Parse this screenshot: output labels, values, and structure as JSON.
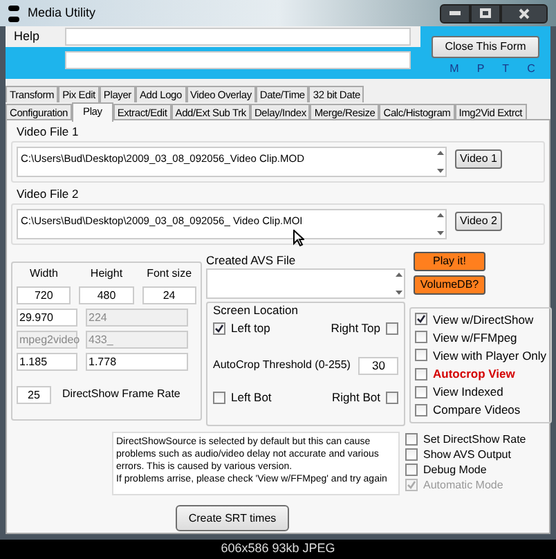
{
  "window": {
    "title": "Media Utility"
  },
  "menu": {
    "items": [
      "Help"
    ]
  },
  "close_button": "Close This Form",
  "indicators": [
    "M",
    "P",
    "T",
    "C"
  ],
  "tab_rows": [
    [
      {
        "label": "Transform",
        "selected": false
      },
      {
        "label": "Pix Edit",
        "selected": false
      },
      {
        "label": "Player",
        "selected": false
      },
      {
        "label": "Add Logo",
        "selected": false
      },
      {
        "label": "Video Overlay",
        "selected": false
      },
      {
        "label": "Date/Time",
        "selected": false
      },
      {
        "label": "32 bit Date",
        "selected": false
      }
    ],
    [
      {
        "label": "Configuration",
        "selected": false
      },
      {
        "label": "Play",
        "selected": true
      },
      {
        "label": "Extract/Edit",
        "selected": false
      },
      {
        "label": "Add/Ext Sub Trk",
        "selected": false
      },
      {
        "label": "Delay/Index",
        "selected": false
      },
      {
        "label": "Merge/Resize",
        "selected": false
      },
      {
        "label": "Calc/Histogram",
        "selected": false
      },
      {
        "label": "Img2Vid Extrct",
        "selected": false
      }
    ]
  ],
  "video_files": [
    {
      "label": "Video File 1",
      "path": "C:\\Users\\Bud\\Desktop\\2009_03_08_092056_Video Clip.MOD",
      "button": "Video 1"
    },
    {
      "label": "Video File 2",
      "path": "C:\\Users\\Bud\\Desktop\\2009_03_08_092056_ Video Clip.MOI",
      "button": "Video 2"
    }
  ],
  "dimensions": {
    "headers": [
      "Width",
      "Height",
      "Font size"
    ],
    "rows": [
      [
        {
          "value": "720",
          "disabled": false
        },
        {
          "value": "480",
          "disabled": false
        },
        {
          "value": "24",
          "disabled": false
        }
      ],
      [
        {
          "value": "29.970",
          "disabled": false
        },
        {
          "value": "224",
          "disabled": true
        }
      ],
      [
        {
          "value": "mpeg2video",
          "disabled": true
        },
        {
          "value": "433_",
          "disabled": true
        }
      ],
      [
        {
          "value": "1.185",
          "disabled": false
        },
        {
          "value": "1.778",
          "disabled": false
        }
      ]
    ]
  },
  "frame_rate": {
    "value": "25",
    "label": "DirectShow Frame Rate"
  },
  "avs_file": {
    "label": "Created AVS File"
  },
  "action_buttons": [
    "Play it!",
    "VolumeDB?"
  ],
  "screen_location": {
    "title": "Screen Location",
    "corners": [
      {
        "label": "Left top",
        "checked": true
      },
      {
        "label": "Right Top",
        "checked": false
      },
      {
        "label": "Left Bot",
        "checked": false
      },
      {
        "label": "Right  Bot",
        "checked": false
      }
    ],
    "threshold": {
      "label": "AutoCrop Threshold (0-255)",
      "value": "30"
    }
  },
  "view_options": [
    {
      "label": "View w/DirectShow",
      "checked": true,
      "emphasized": false
    },
    {
      "label": "View w/FFMpeg",
      "checked": false,
      "emphasized": false
    },
    {
      "label": "View with Player Only",
      "checked": false,
      "emphasized": false
    },
    {
      "label": "Autocrop View",
      "checked": false,
      "emphasized": true
    },
    {
      "label": "View Indexed",
      "checked": false,
      "emphasized": false
    },
    {
      "label": "Compare Videos",
      "checked": false,
      "emphasized": false
    }
  ],
  "note": "DirectShowSource is selected by default but this can cause problems such as audio/video delay not accurate and various errors.  This is caused by various version.\nIf problems arrise, please check 'View w/FFMpeg' and try again",
  "options": [
    {
      "label": "Set DirectShow Rate",
      "checked": false,
      "disabled": false
    },
    {
      "label": "Show AVS Output",
      "checked": false,
      "disabled": false
    },
    {
      "label": "Debug Mode",
      "checked": false,
      "disabled": false
    },
    {
      "label": "Automatic Mode",
      "checked": true,
      "disabled": true
    }
  ],
  "srt_button": "Create SRT times",
  "caption": "606x586 93kb JPEG"
}
